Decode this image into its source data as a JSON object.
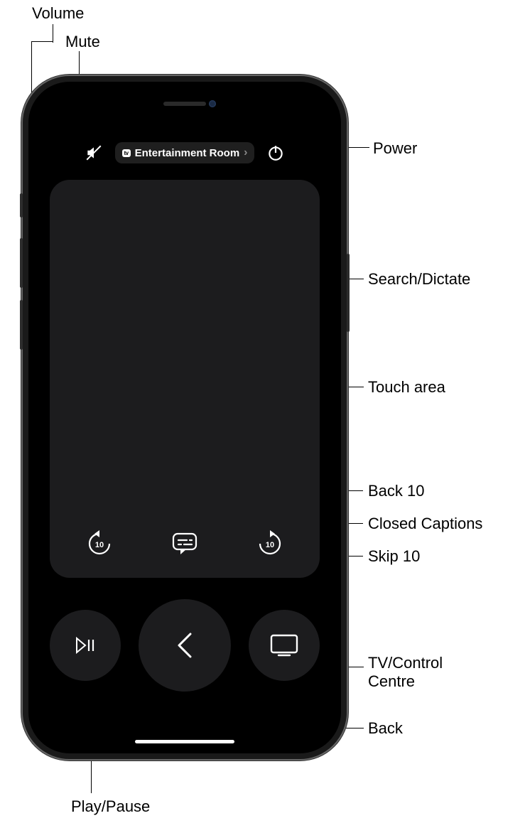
{
  "callouts": {
    "volume": "Volume",
    "mute": "Mute",
    "power": "Power",
    "search_dictate": "Search/Dictate",
    "touch_area": "Touch area",
    "back10": "Back 10",
    "cc": "Closed Captions",
    "skip10": "Skip 10",
    "tv_cc": "TV/Control\nCentre",
    "back": "Back",
    "play_pause": "Play/Pause"
  },
  "remote": {
    "device_badge": "tv",
    "device_name": "Entertainment Room",
    "skip_seconds": "10"
  }
}
